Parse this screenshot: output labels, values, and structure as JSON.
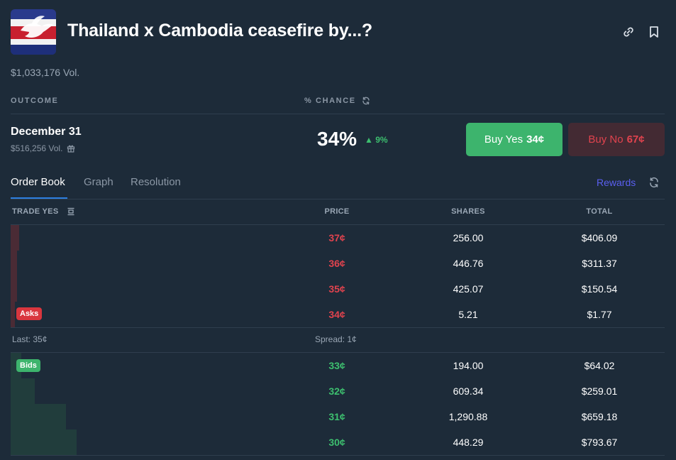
{
  "header": {
    "title": "Thailand x Cambodia ceasefire by...?",
    "volume": "$1,033,176 Vol.",
    "icons": [
      "link-icon",
      "bookmark-icon"
    ]
  },
  "columns": {
    "outcome": "OUTCOME",
    "chance": "% CHANCE"
  },
  "outcome": {
    "name": "December 31",
    "volume": "$516,256 Vol.",
    "chance": "34%",
    "delta": "9%",
    "buy_yes_label": "Buy Yes",
    "buy_yes_price": "34¢",
    "buy_no_label": "Buy No",
    "buy_no_price": "67¢"
  },
  "tabs": [
    {
      "label": "Order Book",
      "active": true
    },
    {
      "label": "Graph",
      "active": false
    },
    {
      "label": "Resolution",
      "active": false
    }
  ],
  "rewards_label": "Rewards",
  "book": {
    "headers": {
      "trade": "TRADE YES",
      "price": "PRICE",
      "shares": "SHARES",
      "total": "TOTAL"
    },
    "asks_badge": "Asks",
    "bids_badge": "Bids",
    "asks": [
      {
        "price": "37¢",
        "shares": "256.00",
        "total": "$406.09",
        "depth": 0.013
      },
      {
        "price": "36¢",
        "shares": "446.76",
        "total": "$311.37",
        "depth": 0.01
      },
      {
        "price": "35¢",
        "shares": "425.07",
        "total": "$150.54",
        "depth": 0.01
      },
      {
        "price": "34¢",
        "shares": "5.21",
        "total": "$1.77",
        "depth": 0.006
      }
    ],
    "last": "Last: 35¢",
    "spread": "Spread: 1¢",
    "bids": [
      {
        "price": "33¢",
        "shares": "194.00",
        "total": "$64.02",
        "depth": 0.016
      },
      {
        "price": "32¢",
        "shares": "609.34",
        "total": "$259.01",
        "depth": 0.037
      },
      {
        "price": "31¢",
        "shares": "1,290.88",
        "total": "$659.18",
        "depth": 0.085
      },
      {
        "price": "30¢",
        "shares": "448.29",
        "total": "$793.67",
        "depth": 0.101
      }
    ]
  },
  "colors": {
    "background": "#1d2b39",
    "yes": "#3db46d",
    "no": "#e0434e",
    "rewards": "#5a5ff0"
  }
}
